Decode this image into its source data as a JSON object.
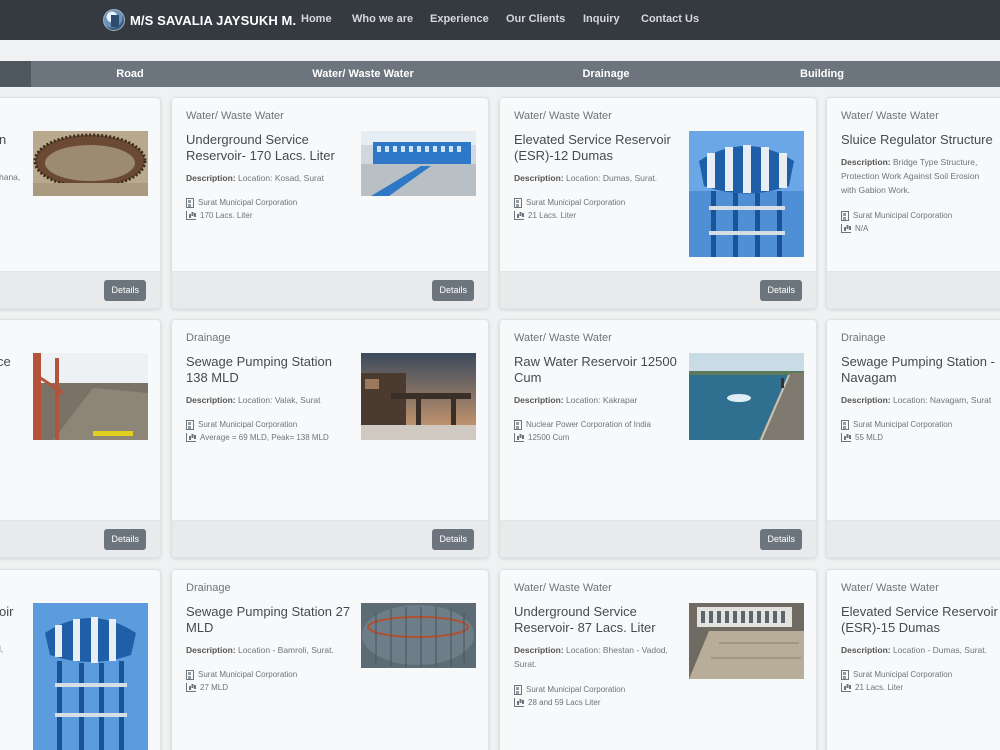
{
  "navbar": {
    "brand": "M/S SAVALIA JAYSUKH M.",
    "links": [
      "Home",
      "Who we are",
      "Experience",
      "Our Clients",
      "Inquiry",
      "Contact Us"
    ]
  },
  "categories": [
    "Road",
    "Water/ Waste Water",
    "Drainage",
    "Building"
  ],
  "cards": [
    {
      "category": "",
      "title": "n",
      "desc_label": "",
      "desc": "hana,",
      "client": "",
      "capacity": "",
      "details": "Details"
    },
    {
      "category": "Water/ Waste Water",
      "title": "Underground Service Reservoir- 170 Lacs. Liter",
      "desc_label": "Description:",
      "desc": "Location: Kosad, Surat",
      "client": "Surat Municipal Corporation",
      "capacity": "170 Lacs. Liter",
      "details": "Details"
    },
    {
      "category": "Water/ Waste Water",
      "title": "Elevated Service Reservoir (ESR)-12 Dumas",
      "desc_label": "Description:",
      "desc": "Location: Dumas, Surat.",
      "client": "Surat Municipal Corporation",
      "capacity": "21 Lacs. Liter",
      "details": "Details"
    },
    {
      "category": "Water/ Waste Water",
      "title": "Sluice Regulator Structure",
      "desc_label": "Description:",
      "desc": "Bridge Type Structure, Protection Work Against Soil Erosion with Gabion Work.",
      "client": "Surat Municipal Corporation",
      "capacity": "N/A",
      "details": ""
    },
    {
      "category": "",
      "title": "ce",
      "desc_label": "",
      "desc": "",
      "client": "",
      "capacity": "",
      "details": "Details"
    },
    {
      "category": "Drainage",
      "title": "Sewage Pumping Station 138 MLD",
      "desc_label": "Description:",
      "desc": "Location: Valak, Surat",
      "client": "Surat Municipal Corporation",
      "capacity": "Average = 69 MLD, Peak= 138 MLD",
      "details": "Details"
    },
    {
      "category": "Water/ Waste Water",
      "title": "Raw Water Reservoir 12500 Cum",
      "desc_label": "Description:",
      "desc": "Location: Kakrapar",
      "client": "Nuclear Power Corporation of India",
      "capacity": "12500 Cum",
      "details": "Details"
    },
    {
      "category": "Drainage",
      "title": "Sewage Pumping Station - Navagam",
      "desc_label": "Description:",
      "desc": "Location: Navagam, Surat",
      "client": "Surat Municipal Corporation",
      "capacity": "55 MLD",
      "details": ""
    },
    {
      "category": "",
      "title": "oir",
      "desc_label": "",
      "desc": "l,",
      "client": "",
      "capacity": "",
      "details": ""
    },
    {
      "category": "Drainage",
      "title": "Sewage Pumping Station 27 MLD",
      "desc_label": "Description:",
      "desc": "Location - Bamroli, Surat.",
      "client": "Surat Municipal Corporation",
      "capacity": "27 MLD",
      "details": ""
    },
    {
      "category": "Water/ Waste Water",
      "title": "Underground Service Reservoir- 87 Lacs. Liter",
      "desc_label": "Description:",
      "desc": "Location: Bhestan - Vadod, Surat.",
      "client": "Surat Municipal Corporation",
      "capacity": "28 and 59 Lacs Liter",
      "details": ""
    },
    {
      "category": "Water/ Waste Water",
      "title": "Elevated Service Reservoir (ESR)-15 Dumas",
      "desc_label": "Description:",
      "desc": "Location - Dumas, Surat.",
      "client": "Surat Municipal Corporation",
      "capacity": "21 Lacs. Liter",
      "details": ""
    }
  ]
}
